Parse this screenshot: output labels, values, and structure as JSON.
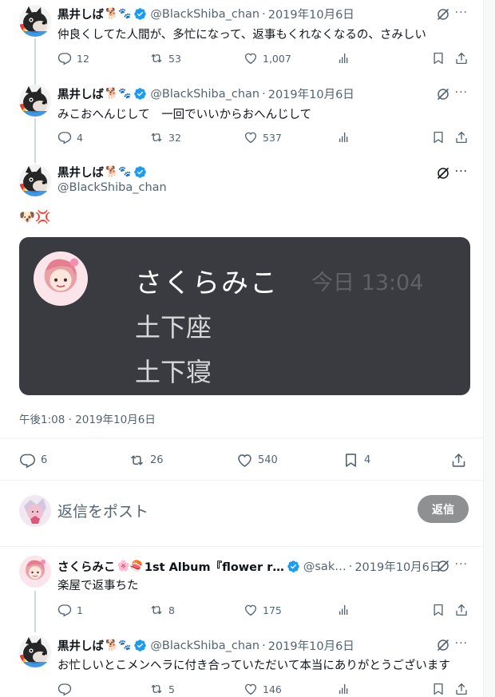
{
  "tweets": [
    {
      "name": "黒井しば",
      "emoji": "🐕🐾",
      "handle": "@BlackShiba_chan",
      "date": "2019年10月6日",
      "text": "仲良くしてた人間が、多忙になって、返事もくれなくなるの、さみしい",
      "replies": "12",
      "retweets": "53",
      "likes": "1,007"
    },
    {
      "name": "黒井しば",
      "emoji": "🐕🐾",
      "handle": "@BlackShiba_chan",
      "date": "2019年10月6日",
      "text": "みこおへんじして　一回でいいからおへんじして",
      "replies": "4",
      "retweets": "32",
      "likes": "537"
    }
  ],
  "main_tweet": {
    "name": "黒井しば",
    "emoji": "🐕🐾",
    "handle": "@BlackShiba_chan",
    "text": "🐶💢",
    "embed": {
      "name": "さくらみこ",
      "time": "今日 13:04",
      "line1": "土下座",
      "line2": "土下寝"
    },
    "timestamp": "午後1:08 · 2019年10月6日",
    "replies": "6",
    "retweets": "26",
    "likes": "540",
    "bookmarks": "4"
  },
  "reply_box": {
    "placeholder": "返信をポスト",
    "button": "返信"
  },
  "replies": [
    {
      "name": "さくらみこ",
      "emoji": "🌸🍣",
      "extra": "1st Album『flower r…",
      "handle": "@sak…",
      "date": "2019年10月6日",
      "text": "楽屋で返事ちた",
      "replies": "1",
      "retweets": "8",
      "likes": "175"
    },
    {
      "name": "黒井しば",
      "emoji": "🐕🐾",
      "handle": "@BlackShiba_chan",
      "date": "2019年10月6日",
      "text": "お忙しいとこメンヘラに付き合っていただいて本当にありがとうございます",
      "replies": "",
      "retweets": "5",
      "likes": "146"
    }
  ],
  "dot": "·",
  "more": "···",
  "colors": {
    "accent": "#1d9bf0",
    "muted": "#536471",
    "embed_bg": "#3a3b40",
    "reply_button": "#8e9092"
  }
}
